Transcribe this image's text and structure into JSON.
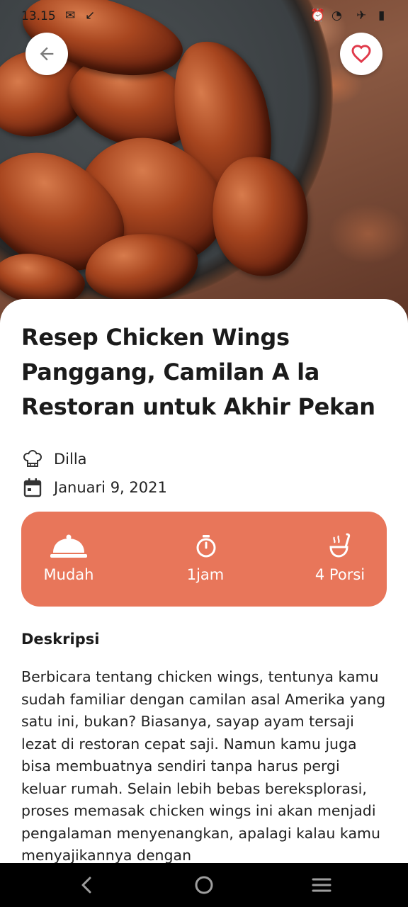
{
  "status_bar": {
    "time": "13.15"
  },
  "header": {
    "back_icon": "arrow-left-icon",
    "favorite_icon": "heart-outline-icon"
  },
  "recipe": {
    "title": "Resep Chicken Wings Panggang, Camilan A la Restoran untuk Akhir Pekan",
    "author": "Dilla",
    "date": "Januari 9, 2021",
    "stats": [
      {
        "icon": "cloche-icon",
        "label": "Mudah"
      },
      {
        "icon": "timer-icon",
        "label": "1jam"
      },
      {
        "icon": "ladle-icon",
        "label": "4 Porsi"
      }
    ],
    "description_heading": "Deskripsi",
    "description": "Berbicara tentang chicken wings, tentunya kamu sudah familiar dengan camilan asal Amerika yang satu ini, bukan? Biasanya, sayap ayam tersaji lezat di restoran cepat saji. Namun kamu juga bisa membuatnya sendiri tanpa harus pergi keluar rumah. Selain lebih bebas bereksplorasi, proses memasak chicken wings ini akan menjadi pengalaman menyenangkan, apalagi kalau kamu menyajikannya dengan"
  },
  "colors": {
    "accent": "#e8765a",
    "favorite": "#e0394a"
  }
}
